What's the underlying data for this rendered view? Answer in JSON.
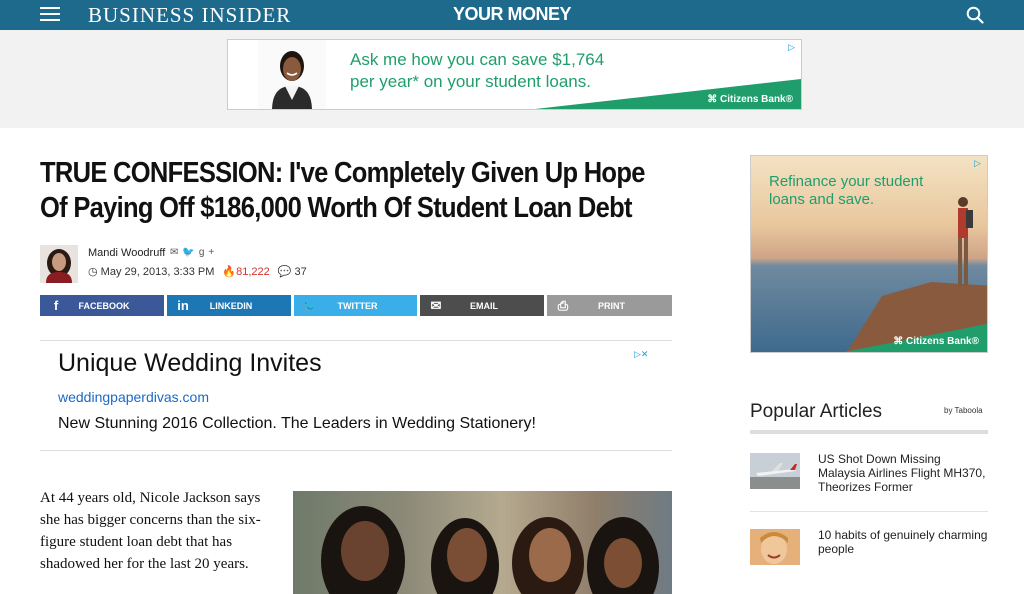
{
  "header": {
    "logo": "BUSINESS INSIDER",
    "section": "YOUR MONEY",
    "menu_icon": "hamburger-icon",
    "search_icon": "search-icon",
    "bg_color": "#1e6a8d"
  },
  "top_ad": {
    "text_line1": "Ask me how you can save $1,764",
    "text_line2": "per year* on your student loans.",
    "brand": "Citizens Bank",
    "color": "#1f9e6c"
  },
  "article": {
    "headline": "TRUE CONFESSION: I've Completely Given Up Hope Of Paying Off $186,000 Worth Of Student Loan Debt",
    "author": "Mandi Woodruff",
    "date": "May 29, 2013, 3:33 PM",
    "views": "81,222",
    "comments": "37",
    "body_intro": "At 44 years old, Nicole Jackson says she has bigger concerns than the six-figure student loan debt that has shadowed her for the last 20 years."
  },
  "share_buttons": [
    {
      "label": "FACEBOOK",
      "icon": "facebook-icon",
      "color": "#3b5998"
    },
    {
      "label": "LINKEDIN",
      "icon": "linkedin-icon",
      "color": "#1d77b5"
    },
    {
      "label": "TWITTER",
      "icon": "twitter-icon",
      "color": "#3aaee8"
    },
    {
      "label": "EMAIL",
      "icon": "email-icon",
      "color": "#4d4d4d"
    },
    {
      "label": "PRINT",
      "icon": "print-icon",
      "color": "#9a9a9a"
    }
  ],
  "text_ad": {
    "title": "Unique Wedding Invites",
    "url": "weddingpaperdivas.com",
    "description": "New Stunning 2016 Collection. The Leaders in Wedding Stationery!"
  },
  "right_ad": {
    "text_line1": "Refinance your student",
    "text_line2": "loans and save.",
    "brand": "Citizens Bank"
  },
  "popular": {
    "title": "Popular Articles",
    "provider": "by Taboola",
    "items": [
      {
        "title": "US Shot Down Missing Malaysia Airlines Flight MH370, Theorizes Former"
      },
      {
        "title": "10 habits of genuinely charming people"
      }
    ]
  }
}
